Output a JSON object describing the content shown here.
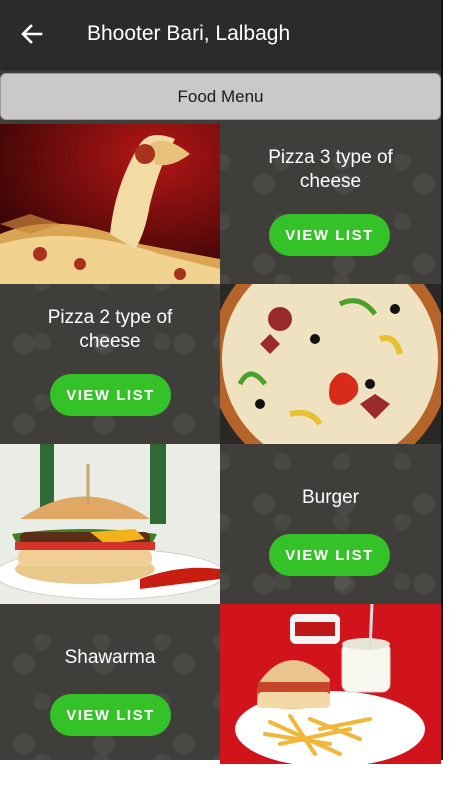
{
  "header": {
    "title": "Bhooter Bari, Lalbagh",
    "back_icon": "arrow-left-icon"
  },
  "menu_bar": {
    "label": "Food Menu"
  },
  "items": [
    {
      "name": "Pizza 3 type of cheese",
      "button": "VIEW  LIST",
      "image": "cheese-pizza-slice-image"
    },
    {
      "name": "Pizza 2 type of cheese",
      "button": "VIEW  LIST",
      "image": "veggie-pizza-image"
    },
    {
      "name": "Burger",
      "button": "VIEW  LIST",
      "image": "burger-plate-image"
    },
    {
      "name": "Shawarma",
      "button": "VIEW  LIST",
      "image": "shawarma-fries-plate-image"
    }
  ],
  "colors": {
    "accent_green": "#34c228",
    "topbar": "#2b2b2b",
    "background": "#3f3e3a"
  }
}
